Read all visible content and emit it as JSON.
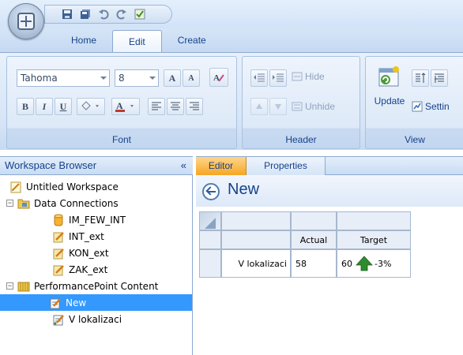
{
  "ribbon": {
    "tabs": [
      {
        "label": "Home"
      },
      {
        "label": "Edit"
      },
      {
        "label": "Create"
      }
    ],
    "font_group": {
      "label": "Font",
      "font_name": "Tahoma",
      "font_size": "8"
    },
    "header_group": {
      "label": "Header",
      "hide_label": "Hide",
      "unhide_label": "Unhide"
    },
    "view_group": {
      "label": "View",
      "update_label": "Update",
      "settings_label": "Settin"
    }
  },
  "workspace_browser": {
    "title": "Workspace Browser",
    "collapse_glyph": "«",
    "items": [
      {
        "label": "Untitled Workspace",
        "icon": "workspace-icon"
      },
      {
        "label": "Data Connections",
        "icon": "folder-icon"
      },
      {
        "label": "IM_FEW_INT",
        "icon": "database-icon"
      },
      {
        "label": "INT_ext",
        "icon": "datasource-icon"
      },
      {
        "label": "KON_ext",
        "icon": "datasource-icon"
      },
      {
        "label": "ZAK_ext",
        "icon": "datasource-icon"
      },
      {
        "label": "PerformancePoint Content",
        "icon": "content-folder-icon"
      },
      {
        "label": "New",
        "icon": "scorecard-icon",
        "selected": true
      },
      {
        "label": "V lokalizaci",
        "icon": "kpi-icon"
      }
    ]
  },
  "editor": {
    "tabs": [
      {
        "label": "Editor"
      },
      {
        "label": "Properties"
      }
    ],
    "title": "New",
    "scorecard": {
      "columns": [
        "Actual",
        "Target"
      ],
      "rows": [
        {
          "label": "V lokalizaci",
          "actual": "58",
          "target": "60",
          "variance": "-3%"
        }
      ]
    }
  },
  "colors": {
    "accent": "#15428b",
    "selection": "#3399ff",
    "active_tab": "#f5a623",
    "indicator_green": "#2e8b2e"
  }
}
